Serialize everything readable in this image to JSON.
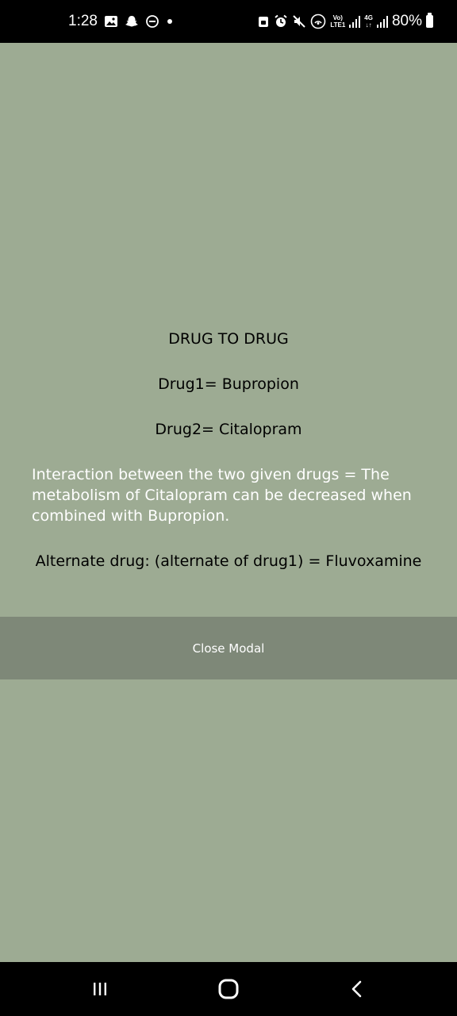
{
  "status_bar": {
    "time": "1:28",
    "volte_label": "Vo)",
    "lte_label": "LTE1",
    "network_label": "4G",
    "battery_percent": "80%",
    "icons_left": [
      "gallery-icon",
      "snapchat-icon",
      "do-not-disturb-icon",
      "notification-dot-icon"
    ],
    "icons_right": [
      "lock-icon",
      "alarm-icon",
      "mute-icon",
      "hotspot-icon",
      "signal-icon",
      "signal-icon",
      "battery-icon"
    ]
  },
  "modal": {
    "heading": "DRUG TO DRUG",
    "drug1": "Drug1= Bupropion",
    "drug2": "Drug2= Citalopram",
    "interaction": "Interaction between the two given drugs = The metabolism of Citalopram can be decreased when combined with Bupropion.",
    "alternate": "Alternate drug: (alternate of drug1) = Fluvoxamine",
    "close_label": "Close Modal"
  },
  "nav_bar": {
    "buttons": [
      "recent-apps-button",
      "home-button",
      "back-button"
    ]
  },
  "colors": {
    "background": "#9dab93",
    "close_bar": "#7e8878",
    "system_bars": "#000000",
    "text": "#ffffff"
  }
}
